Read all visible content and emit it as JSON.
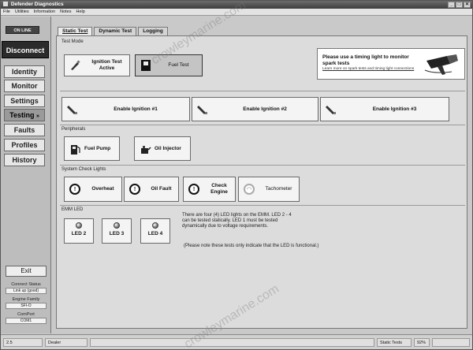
{
  "app": {
    "title": "Defender Diagnostics",
    "window_buttons": [
      "_",
      "□",
      "✕"
    ]
  },
  "menu": [
    "File",
    "Utilities",
    "Information",
    "Notes",
    "Help"
  ],
  "sidebar": {
    "status": "ON LINE",
    "disconnect": "Disconnect",
    "nav": [
      "Identity",
      "Monitor",
      "Settings",
      "Testing",
      "Faults",
      "Profiles",
      "History"
    ],
    "active_nav": "Testing",
    "exit": "Exit",
    "stats": [
      {
        "label": "Connect Status",
        "value": "Link up (good)"
      },
      {
        "label": "Engine Family",
        "value": "SFI-O"
      },
      {
        "label": "ComPort",
        "value": "COM1"
      }
    ]
  },
  "tabs": [
    "Static Test",
    "Dynamic Test",
    "Logging"
  ],
  "active_tab": "Static Test",
  "sections": {
    "test_mode": {
      "label": "Test Mode",
      "buttons": [
        {
          "label": "Ignition Test Active",
          "icon": "spark-plug-icon",
          "pressed": false
        },
        {
          "label": "Fuel Test",
          "icon": "fuel-pump-icon",
          "pressed": true
        }
      ]
    },
    "info": {
      "text": "Please use a timing light to monitor spark tests",
      "link": "Learn more on spark tests and timing light connections",
      "icon": "timing-light-icon"
    },
    "ignition": {
      "buttons": [
        "Enable Ignition #1",
        "Enable Ignition #2",
        "Enable Ignition #3"
      ]
    },
    "peripherals": {
      "label": "Peripherals",
      "buttons": [
        {
          "label": "Fuel Pump",
          "icon": "fuel-pump-icon"
        },
        {
          "label": "Oil Injector",
          "icon": "oil-can-icon"
        }
      ]
    },
    "system_check": {
      "label": "System Check Lights",
      "buttons": [
        {
          "label": "Overheat",
          "icon": "warning-light-icon"
        },
        {
          "label": "Oil Fault",
          "icon": "warning-light-icon"
        },
        {
          "label": "Check Engine",
          "icon": "warning-light-icon"
        },
        {
          "label": "Tachometer",
          "icon": "tachometer-icon"
        }
      ]
    },
    "emm_led": {
      "label": "EMM LED",
      "buttons": [
        "LED 2",
        "LED 3",
        "LED 4"
      ],
      "note_1": "There are four (4) LED lights on the EMM. LED 2 - 4 can be tested statically. LED 1 must be tested dynamically due to voltage requirements.",
      "note_2": "(Please note these tests only indicate that the LED is functional.)"
    }
  },
  "status_bar": {
    "page": "2.5",
    "role": "Dealer",
    "mode": "Static Tests",
    "percent": "92%"
  },
  "watermark": [
    "crowleymarine.com",
    "crowleymarine.com"
  ],
  "colors": {
    "window_bg": "#c9c9c9",
    "panel_bg": "#dcdcdc",
    "disconnect_bg": "#2b2b2b"
  }
}
